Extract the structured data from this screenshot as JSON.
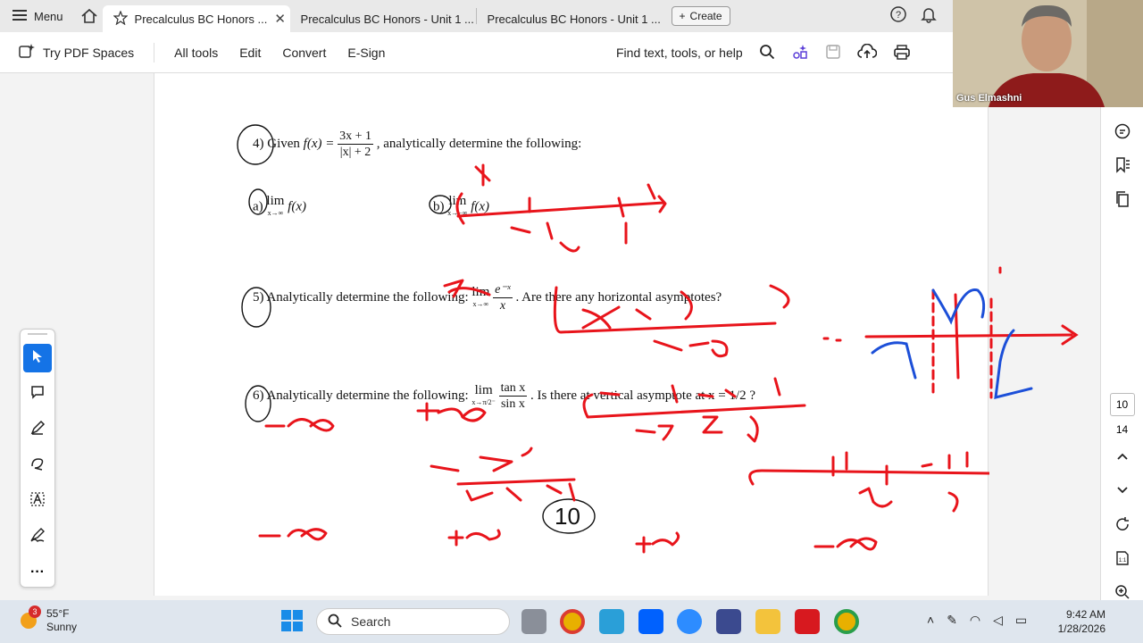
{
  "tabbar": {
    "menu_label": "Menu",
    "tabs": [
      {
        "label": "Precalculus BC Honors ..."
      },
      {
        "label": "Precalculus BC Honors - Unit 1 ..."
      },
      {
        "label": "Precalculus BC Honors - Unit 1 ..."
      }
    ],
    "create_label": "Create"
  },
  "toolbar": {
    "pdf_spaces": "Try PDF Spaces",
    "items": [
      "All tools",
      "Edit",
      "Convert",
      "E-Sign"
    ],
    "find": "Find text, tools, or help"
  },
  "document": {
    "q4_number": "4)",
    "q4_text_pre": "Given",
    "q4_func": "f(x) =",
    "q4_num": "3x + 1",
    "q4_den": "|x| + 2",
    "q4_text_post": ", analytically determine the following:",
    "q4a_label": "a)",
    "q4a_lim": "lim",
    "q4a_sub": "x→∞",
    "q4a_expr": "f(x)",
    "q4b_label": "b)",
    "q4b_lim": "lim",
    "q4b_sub": "x→−∞",
    "q4b_expr": "f(x)",
    "q5_number": "5)",
    "q5_text": "Analytically determine the following:",
    "q5_lim": "lim",
    "q5_sub": "x→∞",
    "q5_num": "e⁻ˣ",
    "q5_den": "x",
    "q5_question": ". Are there any horizontal asymptotes?",
    "q6_number": "6)",
    "q6_text": "Analytically determine the following:",
    "q6_lim": "lim",
    "q6_sub": "x→π/2⁻",
    "q6_num": "tan x",
    "q6_den": "sin x",
    "q6_question": ". Is there at vertical asymptote at x = 1/2 ?"
  },
  "right_rail": {
    "page_current": "10",
    "page_total": "14"
  },
  "webcam": {
    "name": "Gus Elmashni"
  },
  "taskbar": {
    "weather_badge": "3",
    "temp": "55°F",
    "condition": "Sunny",
    "search": "Search",
    "time": "9:42 AM",
    "date": "1/28/2026"
  },
  "colors": {
    "accent": "#1473e6",
    "ink_red": "#e8141b",
    "ink_blue": "#1c4fd8"
  }
}
